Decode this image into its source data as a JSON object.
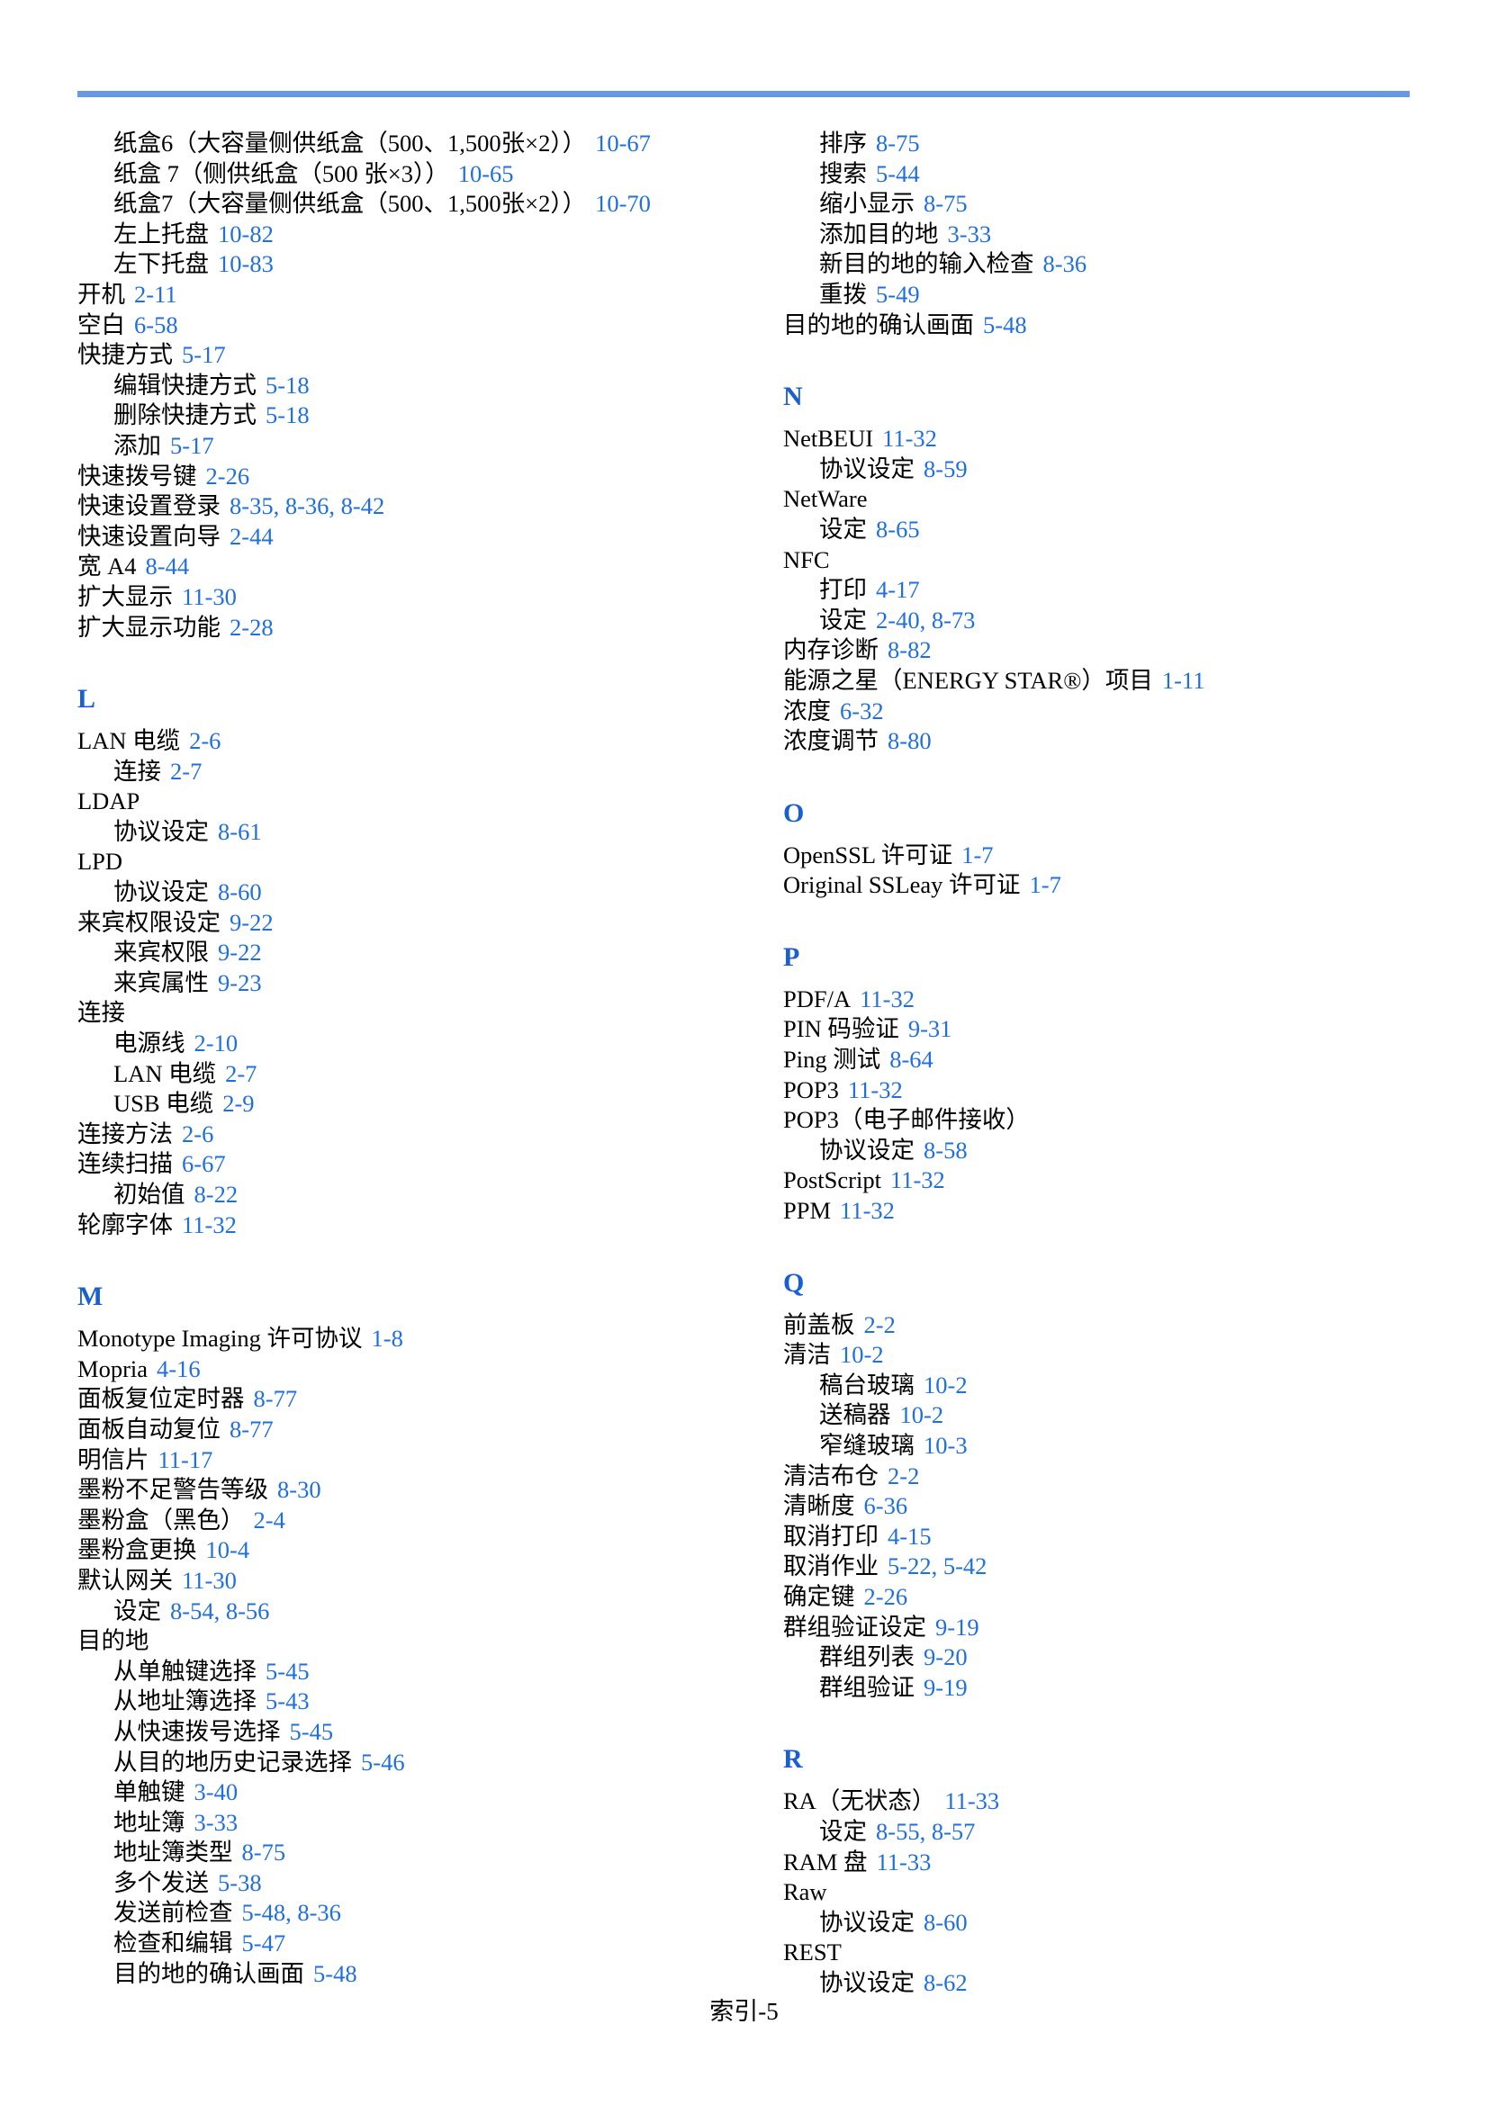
{
  "page": {
    "footer_label": "索引-5",
    "rule_color": "#6699e0",
    "link_color": "#1f6fdd",
    "heading_color": "#1a5fd0"
  },
  "left_column": {
    "sections": [
      {
        "letter": "",
        "entries": [
          {
            "level": 1,
            "term": "纸盒6（大容量侧供纸盒（500、1,500张×2））",
            "pages": "10-67"
          },
          {
            "level": 1,
            "term": "纸盒 7（侧供纸盒（500 张×3））",
            "pages": "10-65"
          },
          {
            "level": 1,
            "term": "纸盒7（大容量侧供纸盒（500、1,500张×2））",
            "pages": "10-70"
          },
          {
            "level": 2,
            "term": "左上托盘",
            "pages": "10-82"
          },
          {
            "level": 2,
            "term": "左下托盘",
            "pages": "10-83"
          },
          {
            "level": 0,
            "term": "开机",
            "pages": "2-11"
          },
          {
            "level": 0,
            "term": "空白",
            "pages": "6-58"
          },
          {
            "level": 0,
            "term": "快捷方式",
            "pages": "5-17"
          },
          {
            "level": 1,
            "term": "编辑快捷方式",
            "pages": "5-18"
          },
          {
            "level": 1,
            "term": "删除快捷方式",
            "pages": "5-18"
          },
          {
            "level": 1,
            "term": "添加",
            "pages": "5-17"
          },
          {
            "level": 0,
            "term": "快速拨号键",
            "pages": "2-26"
          },
          {
            "level": 0,
            "term": "快速设置登录",
            "pages": "8-35, 8-36, 8-42"
          },
          {
            "level": 0,
            "term": "快速设置向导",
            "pages": "2-44"
          },
          {
            "level": 0,
            "term": "宽 A4",
            "pages": "8-44"
          },
          {
            "level": 0,
            "term": "扩大显示",
            "pages": "11-30"
          },
          {
            "level": 0,
            "term": "扩大显示功能",
            "pages": "2-28"
          }
        ]
      },
      {
        "letter": "L",
        "entries": [
          {
            "level": 0,
            "term": "LAN 电缆",
            "pages": "2-6"
          },
          {
            "level": 1,
            "term": "连接",
            "pages": "2-7"
          },
          {
            "level": 0,
            "term": "LDAP",
            "pages": ""
          },
          {
            "level": 1,
            "term": "协议设定",
            "pages": "8-61"
          },
          {
            "level": 0,
            "term": "LPD",
            "pages": ""
          },
          {
            "level": 1,
            "term": "协议设定",
            "pages": "8-60"
          },
          {
            "level": 0,
            "term": "来宾权限设定",
            "pages": "9-22"
          },
          {
            "level": 1,
            "term": "来宾权限",
            "pages": "9-22"
          },
          {
            "level": 1,
            "term": "来宾属性",
            "pages": "9-23"
          },
          {
            "level": 0,
            "term": "连接",
            "pages": ""
          },
          {
            "level": 1,
            "term": "电源线",
            "pages": "2-10"
          },
          {
            "level": 1,
            "term": "LAN 电缆",
            "pages": "2-7"
          },
          {
            "level": 1,
            "term": "USB 电缆",
            "pages": "2-9"
          },
          {
            "level": 0,
            "term": "连接方法",
            "pages": "2-6"
          },
          {
            "level": 0,
            "term": "连续扫描",
            "pages": "6-67"
          },
          {
            "level": 1,
            "term": "初始值",
            "pages": "8-22"
          },
          {
            "level": 0,
            "term": "轮廓字体",
            "pages": "11-32"
          }
        ]
      },
      {
        "letter": "M",
        "entries": [
          {
            "level": 0,
            "term": "Monotype Imaging 许可协议",
            "pages": "1-8"
          },
          {
            "level": 0,
            "term": "Mopria",
            "pages": "4-16"
          },
          {
            "level": 0,
            "term": "面板复位定时器",
            "pages": "8-77"
          },
          {
            "level": 0,
            "term": "面板自动复位",
            "pages": "8-77"
          },
          {
            "level": 0,
            "term": "明信片",
            "pages": "11-17"
          },
          {
            "level": 0,
            "term": "墨粉不足警告等级",
            "pages": "8-30"
          },
          {
            "level": 0,
            "term": "墨粉盒（黑色）",
            "pages": "2-4"
          },
          {
            "level": 0,
            "term": "墨粉盒更换",
            "pages": "10-4"
          },
          {
            "level": 0,
            "term": "默认网关",
            "pages": "11-30"
          },
          {
            "level": 1,
            "term": "设定",
            "pages": "8-54, 8-56"
          },
          {
            "level": 0,
            "term": "目的地",
            "pages": ""
          },
          {
            "level": 1,
            "term": "从单触键选择",
            "pages": "5-45"
          },
          {
            "level": 1,
            "term": "从地址簿选择",
            "pages": "5-43"
          },
          {
            "level": 1,
            "term": "从快速拨号选择",
            "pages": "5-45"
          },
          {
            "level": 1,
            "term": "从目的地历史记录选择",
            "pages": "5-46"
          },
          {
            "level": 1,
            "term": "单触键",
            "pages": "3-40"
          },
          {
            "level": 1,
            "term": "地址簿",
            "pages": "3-33"
          },
          {
            "level": 1,
            "term": "地址簿类型",
            "pages": "8-75"
          },
          {
            "level": 1,
            "term": "多个发送",
            "pages": "5-38"
          },
          {
            "level": 1,
            "term": "发送前检查",
            "pages": "5-48, 8-36"
          },
          {
            "level": 1,
            "term": "检查和编辑",
            "pages": "5-47"
          },
          {
            "level": 1,
            "term": "目的地的确认画面",
            "pages": "5-48"
          }
        ]
      }
    ]
  },
  "right_column": {
    "sections": [
      {
        "letter": "",
        "entries": [
          {
            "level": 1,
            "term": "排序",
            "pages": "8-75"
          },
          {
            "level": 1,
            "term": "搜索",
            "pages": "5-44"
          },
          {
            "level": 1,
            "term": "缩小显示",
            "pages": "8-75"
          },
          {
            "level": 1,
            "term": "添加目的地",
            "pages": "3-33"
          },
          {
            "level": 1,
            "term": "新目的地的输入检查",
            "pages": "8-36"
          },
          {
            "level": 1,
            "term": "重拨",
            "pages": "5-49"
          },
          {
            "level": 0,
            "term": "目的地的确认画面",
            "pages": "5-48"
          }
        ]
      },
      {
        "letter": "N",
        "entries": [
          {
            "level": 0,
            "term": "NetBEUI",
            "pages": "11-32"
          },
          {
            "level": 1,
            "term": "协议设定",
            "pages": "8-59"
          },
          {
            "level": 0,
            "term": "NetWare",
            "pages": ""
          },
          {
            "level": 1,
            "term": "设定",
            "pages": "8-65"
          },
          {
            "level": 0,
            "term": "NFC",
            "pages": ""
          },
          {
            "level": 1,
            "term": "打印",
            "pages": "4-17"
          },
          {
            "level": 1,
            "term": "设定",
            "pages": "2-40, 8-73"
          },
          {
            "level": 0,
            "term": "内存诊断",
            "pages": "8-82"
          },
          {
            "level": 0,
            "term": "能源之星（ENERGY STAR®）项目",
            "pages": "1-11"
          },
          {
            "level": 0,
            "term": "浓度",
            "pages": "6-32"
          },
          {
            "level": 0,
            "term": "浓度调节",
            "pages": "8-80"
          }
        ]
      },
      {
        "letter": "O",
        "entries": [
          {
            "level": 0,
            "term": "OpenSSL 许可证",
            "pages": "1-7"
          },
          {
            "level": 0,
            "term": "Original SSLeay 许可证",
            "pages": "1-7"
          }
        ]
      },
      {
        "letter": "P",
        "entries": [
          {
            "level": 0,
            "term": "PDF/A",
            "pages": "11-32"
          },
          {
            "level": 0,
            "term": "PIN 码验证",
            "pages": "9-31"
          },
          {
            "level": 0,
            "term": "Ping 测试",
            "pages": "8-64"
          },
          {
            "level": 0,
            "term": "POP3",
            "pages": "11-32"
          },
          {
            "level": 0,
            "term": "POP3（电子邮件接收）",
            "pages": ""
          },
          {
            "level": 1,
            "term": "协议设定",
            "pages": "8-58"
          },
          {
            "level": 0,
            "term": "PostScript",
            "pages": "11-32"
          },
          {
            "level": 0,
            "term": "PPM",
            "pages": "11-32"
          }
        ]
      },
      {
        "letter": "Q",
        "entries": [
          {
            "level": 0,
            "term": "前盖板",
            "pages": "2-2"
          },
          {
            "level": 0,
            "term": "清洁",
            "pages": "10-2"
          },
          {
            "level": 1,
            "term": "稿台玻璃",
            "pages": "10-2"
          },
          {
            "level": 1,
            "term": "送稿器",
            "pages": "10-2"
          },
          {
            "level": 1,
            "term": "窄缝玻璃",
            "pages": "10-3"
          },
          {
            "level": 0,
            "term": "清洁布仓",
            "pages": "2-2"
          },
          {
            "level": 0,
            "term": "清晰度",
            "pages": "6-36"
          },
          {
            "level": 0,
            "term": "取消打印",
            "pages": "4-15"
          },
          {
            "level": 0,
            "term": "取消作业",
            "pages": "5-22, 5-42"
          },
          {
            "level": 0,
            "term": "确定键",
            "pages": "2-26"
          },
          {
            "level": 0,
            "term": "群组验证设定",
            "pages": "9-19"
          },
          {
            "level": 1,
            "term": "群组列表",
            "pages": "9-20"
          },
          {
            "level": 1,
            "term": "群组验证",
            "pages": "9-19"
          }
        ]
      },
      {
        "letter": "R",
        "entries": [
          {
            "level": 0,
            "term": "RA（无状态）",
            "pages": "11-33"
          },
          {
            "level": 1,
            "term": "设定",
            "pages": "8-55, 8-57"
          },
          {
            "level": 0,
            "term": "RAM 盘",
            "pages": "11-33"
          },
          {
            "level": 0,
            "term": "Raw",
            "pages": ""
          },
          {
            "level": 1,
            "term": "协议设定",
            "pages": "8-60"
          },
          {
            "level": 0,
            "term": "REST",
            "pages": ""
          },
          {
            "level": 1,
            "term": "协议设定",
            "pages": "8-62"
          }
        ]
      }
    ]
  }
}
